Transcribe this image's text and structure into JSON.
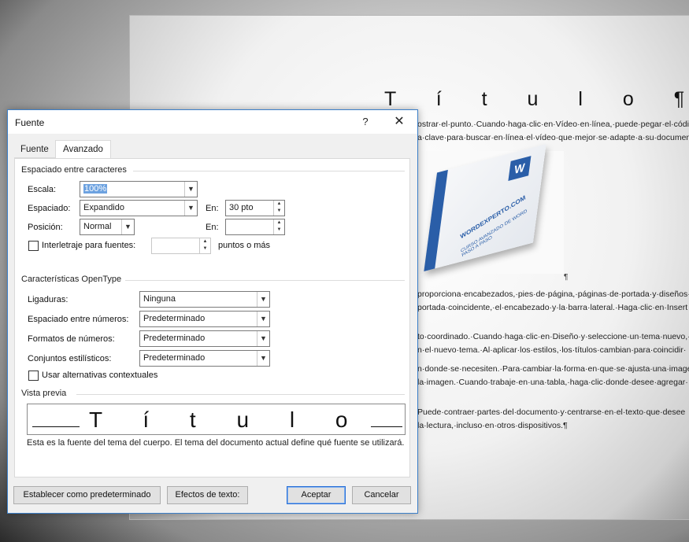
{
  "document": {
    "title": "T í t u l o ¶",
    "lines": [
      "ostrar·el·punto.·Cuando·haga·clic·en·Vídeo·en·línea,·puede·pegar·el·códig",
      "a·clave·para·buscar·en·línea·el·vídeo·que·mejor·se·adapte·a·su·document",
      "proporciona·encabezados,·pies·de·página,·páginas·de·portada·y·diseños·c",
      "portada·coincidente,·el·encabezado·y·la·barra·lateral.·Haga·clic·en·Insert",
      "to·coordinado.·Cuando·haga·clic·en·Diseño·y·seleccione·un·tema·nuevo,·",
      "n·el·nuevo·tema.·Al·aplicar·los·estilos,·los·títulos·cambian·para·coincidir·",
      "n·donde·se·necesiten.·Para·cambiar·la·forma·en·que·se·ajusta·una·image",
      "la·imagen.·Cuando·trabaje·en·una·tabla,·haga·clic·donde·desee·agregar·",
      "Puede·contraer·partes·del·documento·y·centrarse·en·el·texto·que·desee",
      "la·lectura,·incluso·en·otros·dispositivos.¶"
    ],
    "pilcrow": "¶",
    "book_logo": "W",
    "book_text_1": "WORDEXPERTO.COM",
    "book_text_2": "CURSO AVANZADO DE WORD PASO A PASO"
  },
  "dialog": {
    "title": "Fuente",
    "help": "?",
    "close": "✕",
    "tabs": [
      {
        "label": "Fuente",
        "underline": "u",
        "active": false
      },
      {
        "label": "Avanzado",
        "underline": "v",
        "active": true
      }
    ],
    "spacing_group": {
      "title": "Espaciado entre caracteres",
      "scale_label": "Escala:",
      "scale_value": "100%",
      "spacing_label": "Espaciado:",
      "spacing_value": "Expandido",
      "spacing_by_label": "En:",
      "spacing_by_value": "30 pto",
      "position_label": "Posición:",
      "position_value": "Normal",
      "position_by_label": "En:",
      "position_by_value": "",
      "kerning_label": "Interletraje para fuentes:",
      "kerning_checked": false,
      "kerning_value": "",
      "kerning_suffix": "puntos o más"
    },
    "opentype_group": {
      "title": "Características OpenType",
      "ligatures_label": "Ligaduras:",
      "ligatures_value": "Ninguna",
      "number_spacing_label": "Espaciado entre números:",
      "number_spacing_value": "Predeterminado",
      "number_forms_label": "Formatos de números:",
      "number_forms_value": "Predeterminado",
      "stylistic_sets_label": "Conjuntos estilísticos:",
      "stylistic_sets_value": "Predeterminado",
      "contextual_label": "Usar alternativas contextuales",
      "contextual_checked": false
    },
    "preview": {
      "title": "Vista previa",
      "sample": "T í t u l o",
      "note": "Esta es la fuente del tema del cuerpo. El tema del documento actual define qué fuente se utilizará."
    },
    "buttons": {
      "set_default": "Establecer como predeterminado",
      "text_effects": "Efectos de texto:",
      "ok": "Aceptar",
      "cancel": "Cancelar"
    }
  }
}
